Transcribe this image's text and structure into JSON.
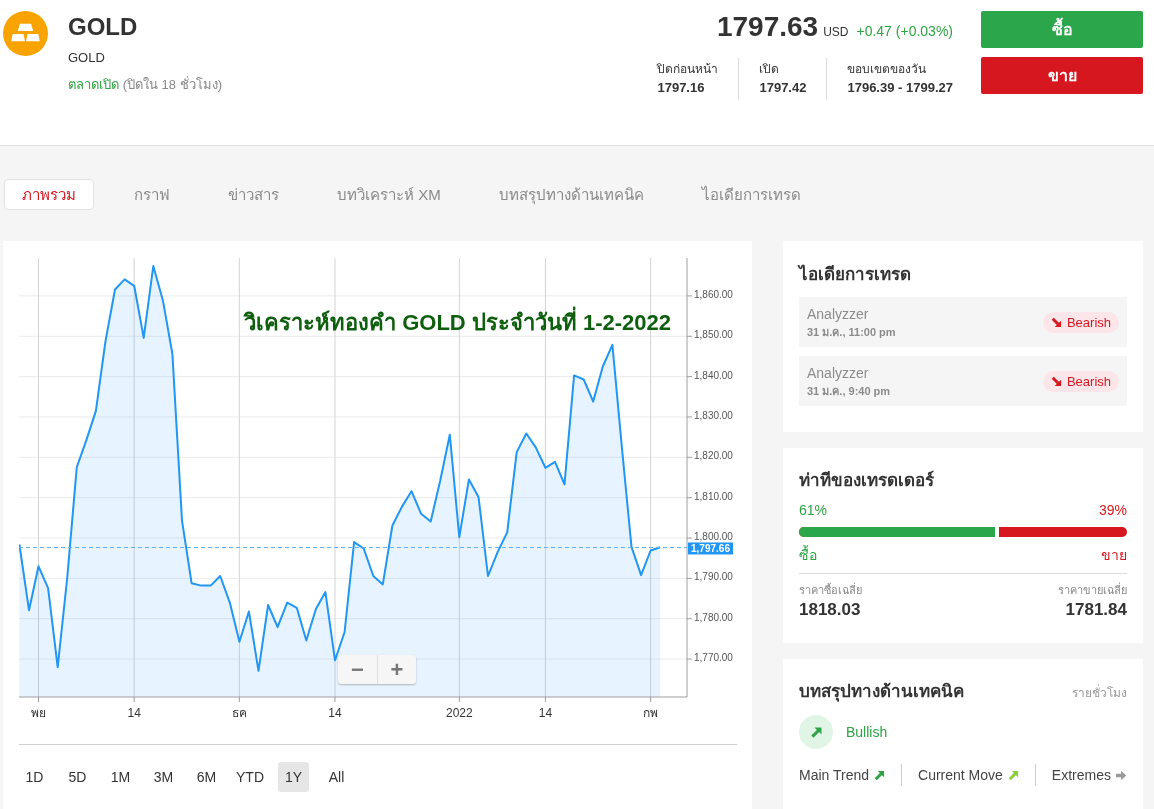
{
  "header": {
    "instrument": {
      "title": "GOLD",
      "subtitle": "GOLD",
      "market_status": "ตลาดเปิด",
      "market_open": true,
      "market_hours": "(ปิดใน 18 ชั่วโมง)"
    },
    "quote": {
      "price": "1797.63",
      "currency": "USD",
      "change": "+0.47 (+0.03%)",
      "positive": true
    },
    "stats": [
      {
        "label": "ปิดก่อนหน้า",
        "value": "1797.16"
      },
      {
        "label": "เปิด",
        "value": "1797.42"
      },
      {
        "label": "ขอบเขตของวัน",
        "value": "1796.39 - 1799.27"
      }
    ],
    "actions": [
      {
        "kind": "buy",
        "label": "ซื้อ"
      },
      {
        "kind": "sell",
        "label": "ขาย"
      }
    ]
  },
  "tabs": [
    {
      "label": "ภาพรวม",
      "selected": true
    },
    {
      "label": "กราฟ",
      "selected": false
    },
    {
      "label": "ข่าวสาร",
      "selected": false
    },
    {
      "label": "บทวิเคราะห์ XM",
      "selected": false
    },
    {
      "label": "บทสรุปทางด้านเทคนิค",
      "selected": false
    },
    {
      "label": "ไอเดียการเทรด",
      "selected": false
    }
  ],
  "chart_panel": {
    "chart_data": {
      "type": "area",
      "title": "วิเคราะห์ทองคำ GOLD ประจำวันที่ 1-2-2022",
      "grid": true,
      "categories": [
        null,
        null,
        "พย",
        null,
        null,
        null,
        null,
        null,
        null,
        null,
        null,
        null,
        "14",
        null,
        null,
        null,
        null,
        null,
        null,
        null,
        null,
        null,
        null,
        "ธค",
        null,
        null,
        null,
        null,
        null,
        null,
        null,
        null,
        null,
        "14",
        null,
        null,
        null,
        null,
        null,
        null,
        null,
        null,
        null,
        null,
        null,
        null,
        "2022",
        null,
        null,
        null,
        null,
        null,
        null,
        null,
        null,
        "14",
        null,
        null,
        null,
        null,
        null,
        null,
        null,
        null,
        null,
        null,
        "กพ",
        null
      ],
      "series": [
        {
          "color": "#2196f3",
          "values": [
            1798.4,
            1782.1,
            1793.0,
            1787.6,
            1768.0,
            1790.1,
            1817.6,
            1824.2,
            1831.5,
            1848.8,
            1861.6,
            1864.1,
            1862.5,
            1849.6,
            1867.4,
            1858.9,
            1845.6,
            1804.3,
            1788.8,
            1788.2,
            1788.2,
            1790.6,
            1784.0,
            1774.3,
            1781.8,
            1767.1,
            1783.4,
            1777.9,
            1784.0,
            1782.7,
            1774.6,
            1782.4,
            1786.6,
            1769.7,
            1776.7,
            1799.0,
            1797.4,
            1790.6,
            1788.5,
            1803.1,
            1807.8,
            1811.6,
            1806.0,
            1804.1,
            1814.2,
            1825.6,
            1800.2,
            1814.5,
            1810.2,
            1790.6,
            1796.5,
            1801.4,
            1821.3,
            1825.9,
            1822.4,
            1817.4,
            1818.9,
            1813.3,
            1840.3,
            1839.3,
            1833.8,
            1842.5,
            1847.9,
            1822.4,
            1797.8,
            1790.8,
            1796.9,
            1797.7
          ]
        }
      ],
      "ylim": [
        1760.6,
        1869.4
      ],
      "yticks": [
        {
          "value": 1770,
          "label": "1,770.00"
        },
        {
          "value": 1780,
          "label": "1,780.00"
        },
        {
          "value": 1790,
          "label": "1,790.00"
        },
        {
          "value": 1800,
          "label": "1,800.00"
        },
        {
          "value": 1810,
          "label": "1,810.00"
        },
        {
          "value": 1820,
          "label": "1,820.00"
        },
        {
          "value": 1830,
          "label": "1,830.00"
        },
        {
          "value": 1840,
          "label": "1,840.00"
        },
        {
          "value": 1850,
          "label": "1,850.00"
        },
        {
          "value": 1860,
          "label": "1,860.00"
        }
      ],
      "ref_lines": [
        {
          "axis": "y",
          "value": 1797.66,
          "label": "1,797.66",
          "color": "#62b0f2"
        }
      ]
    },
    "zoom_controls": [
      "−",
      "+"
    ],
    "ranges": [
      {
        "label": "1D",
        "selected": false
      },
      {
        "label": "5D",
        "selected": false
      },
      {
        "label": "1M",
        "selected": false
      },
      {
        "label": "3M",
        "selected": false
      },
      {
        "label": "6M",
        "selected": false
      },
      {
        "label": "YTD",
        "selected": false
      },
      {
        "label": "1Y",
        "selected": true
      },
      {
        "label": "All",
        "selected": false
      }
    ]
  },
  "trade_ideas": {
    "title": "ไอเดียการเทรด",
    "items": [
      {
        "author": "Analyzzer",
        "time": "31 ม.ค., 11:00 pm",
        "kind": "bearish",
        "label": "Bearish"
      },
      {
        "author": "Analyzzer",
        "time": "31 ม.ค., 9:40 pm",
        "kind": "bearish",
        "label": "Bearish"
      }
    ]
  },
  "traders": {
    "title": "ท่าทีของเทรดเดอร์",
    "buy_percent": "61%",
    "sell_percent": "39%",
    "level": 0.61,
    "buy_label": "ซื้อ",
    "sell_label": "ขาย",
    "avg_buy_label": "ราคาซื้อเฉลี่ย",
    "avg_buy": "1818.03",
    "avg_sell_label": "ราคาขายเฉลี่ย",
    "avg_sell": "1781.84"
  },
  "technical_summary": {
    "title": "บทสรุปทางด้านเทคนิค",
    "period": "รายชั่วโมง",
    "overall": {
      "kind": "bullish",
      "label": "Bullish"
    },
    "indicators": [
      {
        "label": "Main Trend",
        "kind": "bullish"
      },
      {
        "label": "Current Move",
        "kind": "weak_bullish"
      },
      {
        "label": "Extremes",
        "kind": "neutral"
      }
    ]
  }
}
